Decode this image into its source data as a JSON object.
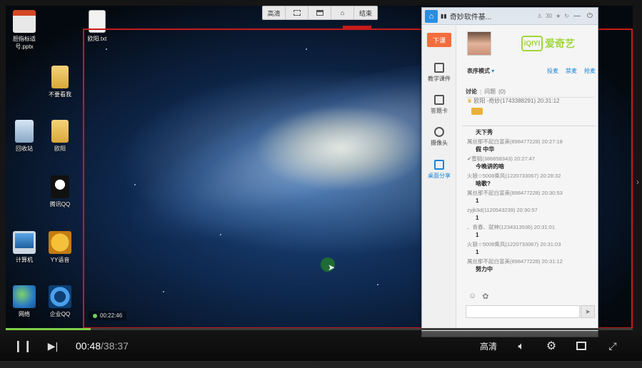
{
  "toolbar": {
    "items": [
      "高清",
      "",
      "",
      "",
      "结束"
    ]
  },
  "desktop": {
    "icons": [
      {
        "label": "胆指标适号.pptx"
      },
      {
        "label": "欧阳.txt"
      },
      {
        "label": "不要看我"
      },
      {
        "label": "回收站"
      },
      {
        "label": "欧阳"
      },
      {
        "label": "腾讯QQ"
      },
      {
        "label": "计算机"
      },
      {
        "label": "YY语音"
      },
      {
        "label": "网络"
      },
      {
        "label": "企业QQ"
      }
    ],
    "timer": "00:22:46"
  },
  "app": {
    "title": "奇妙软件基...",
    "count": "30",
    "end_class": "下课",
    "side_items": [
      "教学课件",
      "答题卡",
      "摄像头",
      "桌面分享"
    ],
    "logo_box": "iQIYI",
    "logo_text": "爱奇艺",
    "mode": "表序模式",
    "mode_links": [
      "投麦",
      "禁麦",
      "抢麦"
    ],
    "tabs": [
      "讨论",
      "问题",
      "(0)"
    ],
    "first_message": "欧阳 -奇妙(1743388291) 20:31:12",
    "chat": [
      {
        "who": "",
        "body": "天下秀"
      },
      {
        "who": "属丝那不起白富美(898477228) 20:27:18",
        "body": "假  中华"
      },
      {
        "who": "✔蜜桃(386858343) 20:27:47",
        "body": "今晚讲的啥"
      },
      {
        "who": "火狼☆5008乘风(1220733067) 20:28:32",
        "body": "啥歌?"
      },
      {
        "who": "属丝那不起白富美(898477228) 20:30:53",
        "body": "1"
      },
      {
        "who": "zyjk3d(1120543239) 20:30:57",
        "body": "1"
      },
      {
        "who": "、青春、就神(1234313536) 20:31:01",
        "body": "1"
      },
      {
        "who": "火狼☆5008乘风(1220733067) 20:31:03",
        "body": "1"
      },
      {
        "who": "属丝那不起白富美(898477228) 20:31:12",
        "body": "努力中"
      }
    ]
  },
  "player": {
    "current_time": "00:48",
    "total_time": "/38:37",
    "quality": "高清",
    "progress_percent": 13.5
  },
  "icons": {
    "pause": "pause-icon",
    "next": "next-icon",
    "volume": "volume-icon",
    "settings": "settings-icon",
    "window": "window-icon",
    "fullscreen": "fullscreen-icon"
  },
  "colors": {
    "progress": "#7fd04a",
    "record_border": "#c81a1a",
    "accent": "#1a86d8",
    "end_class": "#f26d3d"
  }
}
